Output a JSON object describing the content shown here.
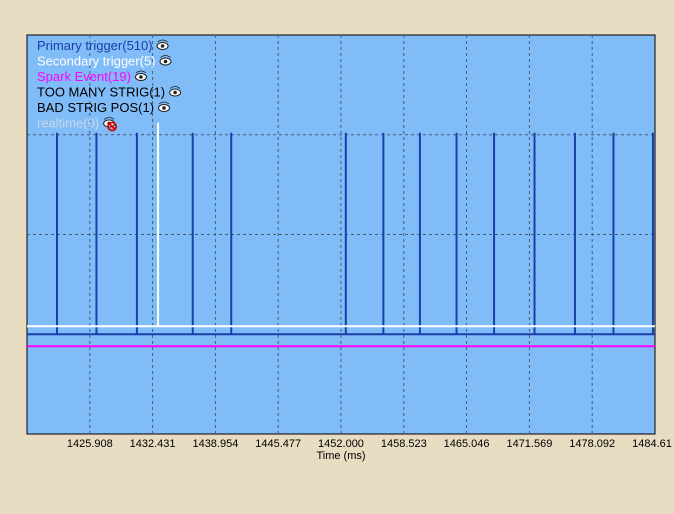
{
  "chart_data": {
    "type": "event-timeline",
    "xlabel": "Time (ms)",
    "xlim": [
      1419.385,
      1484.615
    ],
    "x_ticks": [
      1425.908,
      1432.431,
      1438.954,
      1445.477,
      1452.0,
      1458.523,
      1465.046,
      1471.569,
      1478.092,
      1484.615
    ],
    "x_tick_labels": [
      "1425.908",
      "1432.431",
      "1438.954",
      "1445.477",
      "1452.000",
      "1458.523",
      "1465.046",
      "1471.569",
      "1478.092",
      "1484.61"
    ],
    "grid": true,
    "legend_position": "top-left",
    "colors": {
      "plot_background": "#80bcf8",
      "page_background": "#e8dcc2",
      "grid": "#4a5c70"
    },
    "series": [
      {
        "name": "Primary trigger(510)",
        "color": "#1b3fa8",
        "visible": true,
        "level_fraction": 0.25,
        "events": [
          1422.5,
          1426.6,
          1430.8,
          1436.6,
          1440.6,
          1452.5,
          1456.4,
          1460.2,
          1464.0,
          1467.9,
          1472.1,
          1476.3,
          1480.3,
          1484.4
        ]
      },
      {
        "name": "Secondary trigger(5)",
        "color": "#ffffff",
        "visible": true,
        "level_fraction": 0.27,
        "events": [
          1433.0
        ]
      },
      {
        "name": "Spark Event(19)",
        "color": "#ff00ff",
        "visible": true,
        "level_fraction": 0.22
      },
      {
        "name": "TOO MANY STRIG(1)",
        "color": "#000000",
        "visible": true
      },
      {
        "name": "BAD STRIG POS(1)",
        "color": "#000000",
        "visible": true
      },
      {
        "name": "realtime(0)",
        "color": "#c8d8e8",
        "visible": false
      }
    ]
  }
}
